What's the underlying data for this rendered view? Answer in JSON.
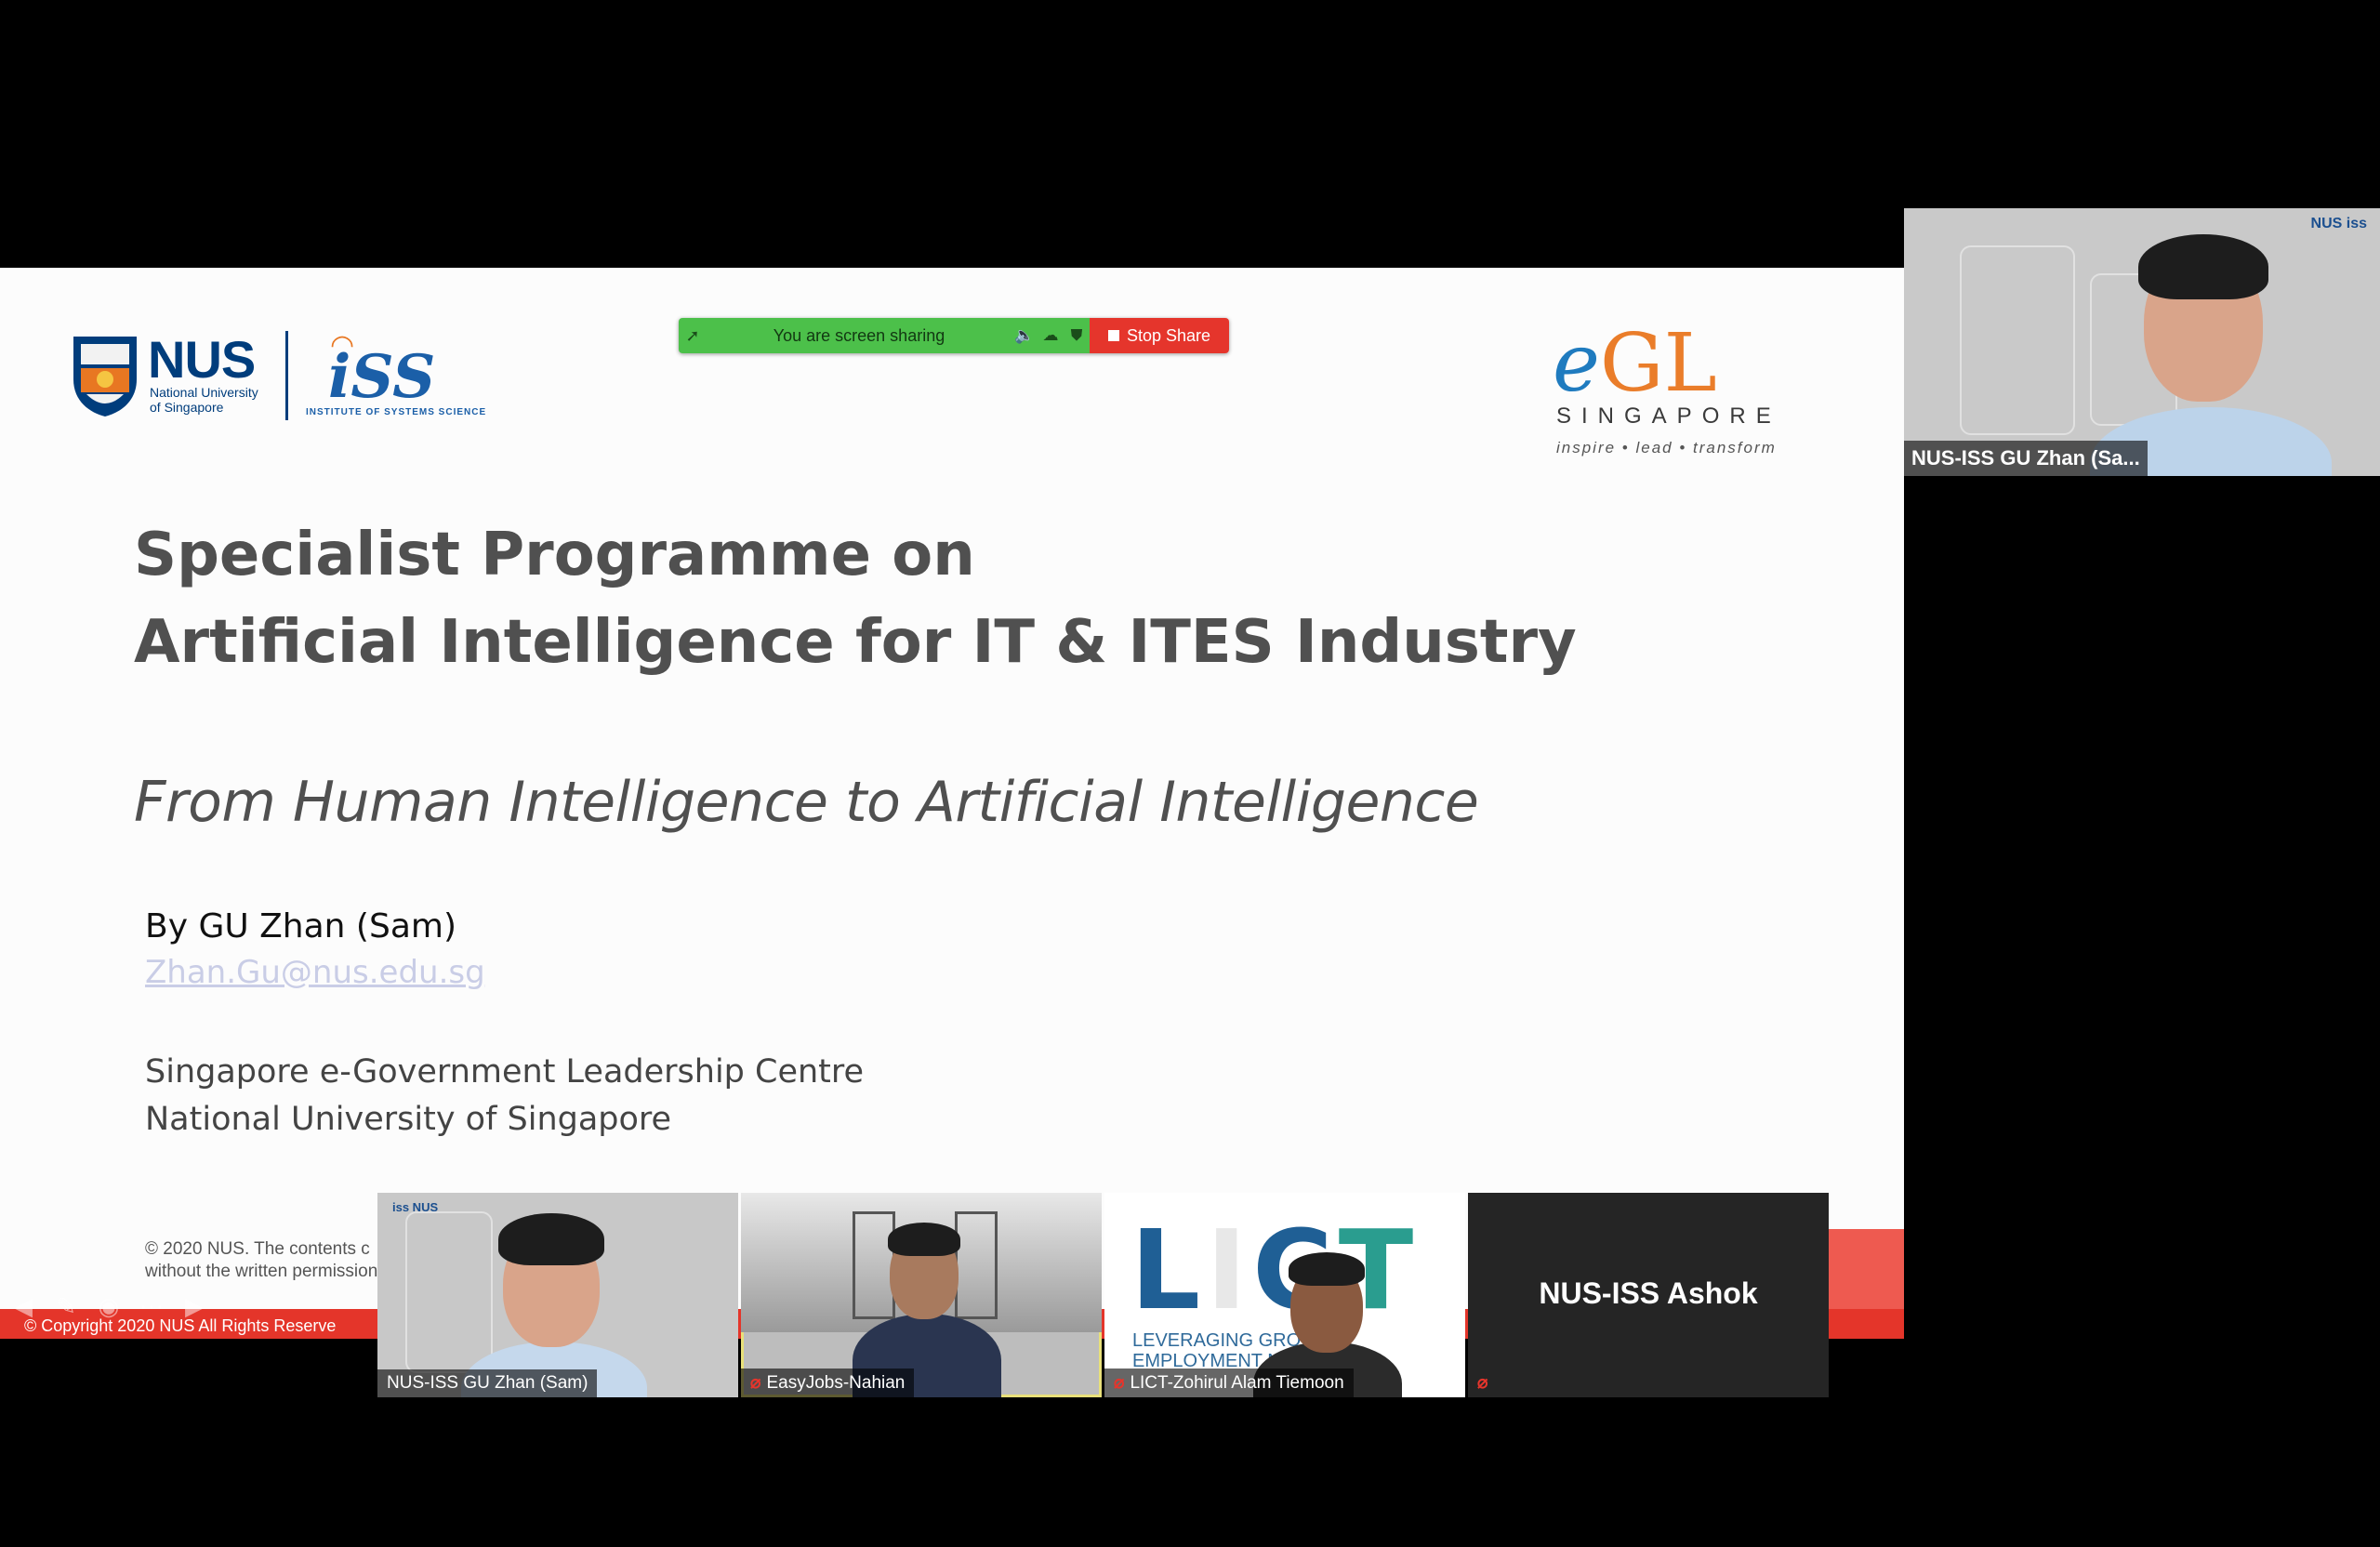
{
  "slide": {
    "nus_logo_text": "NUS",
    "nus_logo_sub_line1": "National University",
    "nus_logo_sub_line2": "of Singapore",
    "iss_logo_text": "iSS",
    "iss_logo_sub": "INSTITUTE OF SYSTEMS SCIENCE",
    "egl_logo_e": "e",
    "egl_logo_gl": "GL",
    "egl_logo_singapore": "SINGAPORE",
    "egl_logo_tagline": "inspire • lead • transform",
    "title_line1": "Specialist Programme on",
    "title_line2": "Artificial Intelligence for IT & ITES Industry",
    "subtitle": "From Human Intelligence to Artificial Intelligence",
    "author": "By GU Zhan (Sam)",
    "email": "Zhan.Gu@nus.edu.sg",
    "org_line1": "Singapore e-Government Leadership Centre",
    "org_line2": "National University of Singapore",
    "copyright_note_line1": "© 2020  NUS. The contents c",
    "copyright_note_line2": "without the written permission",
    "copyright_bar": "© Copyright 2020 NUS  All Rights Reserve"
  },
  "share_toolbar": {
    "message": "You are screen sharing",
    "stop_label": "Stop Share",
    "colors": {
      "bar": "#4cc04a",
      "stop": "#e5352c"
    }
  },
  "self_view": {
    "name": "NUS-ISS GU Zhan (Sa...",
    "logos": "NUS  iss"
  },
  "gallery": [
    {
      "name": "NUS-ISS GU Zhan (Sam)",
      "logos": "iss NUS"
    },
    {
      "name": "EasyJobs-Nahian"
    },
    {
      "name": "LICT-Zohirul Alam Tiemoon",
      "logo_letters": "LICT",
      "logo_sub_line1": "LEVERAGING      GROWTH",
      "logo_sub_line2": "EMPLOYMENT      NANCE"
    },
    {
      "name": "NUS-ISS Ashok"
    }
  ],
  "colors": {
    "slide_red": "#e4352a",
    "nus_blue": "#003d7c",
    "egl_blue": "#1f7bbf",
    "egl_orange": "#ea7d2a",
    "email_link": "#c9cde6"
  }
}
